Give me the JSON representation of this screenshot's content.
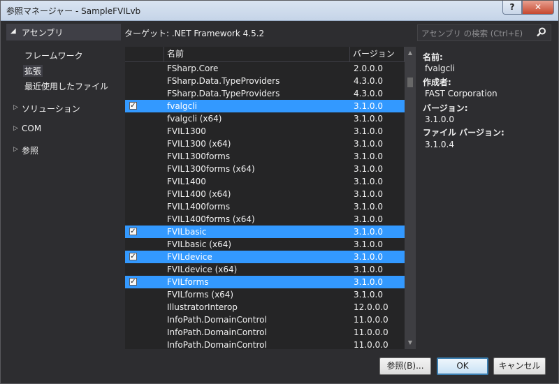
{
  "window": {
    "title": "参照マネージャー - SampleFVILvb",
    "help": "?",
    "close": "✕"
  },
  "left": {
    "header": "アセンブリ",
    "sub_items": [
      "フレームワーク",
      "拡張",
      "最近使用したファイル"
    ],
    "groups": [
      "ソリューション",
      "COM",
      "参照"
    ]
  },
  "target": "ターゲット: .NET Framework 4.5.2",
  "search": {
    "placeholder": "アセンブリ の検索 (Ctrl+E)"
  },
  "list": {
    "columns": [
      "名前",
      "バージョン"
    ],
    "rows": [
      {
        "name": "FSharp.Core",
        "version": "2.0.0.0",
        "checked": false
      },
      {
        "name": "FSharp.Data.TypeProviders",
        "version": "4.3.0.0",
        "checked": false
      },
      {
        "name": "FSharp.Data.TypeProviders",
        "version": "4.3.0.0",
        "checked": false
      },
      {
        "name": "fvalgcli",
        "version": "3.1.0.0",
        "checked": true
      },
      {
        "name": "fvalgcli (x64)",
        "version": "3.1.0.0",
        "checked": false
      },
      {
        "name": "FVIL1300",
        "version": "3.1.0.0",
        "checked": false
      },
      {
        "name": "FVIL1300 (x64)",
        "version": "3.1.0.0",
        "checked": false
      },
      {
        "name": "FVIL1300forms",
        "version": "3.1.0.0",
        "checked": false
      },
      {
        "name": "FVIL1300forms (x64)",
        "version": "3.1.0.0",
        "checked": false
      },
      {
        "name": "FVIL1400",
        "version": "3.1.0.0",
        "checked": false
      },
      {
        "name": "FVIL1400 (x64)",
        "version": "3.1.0.0",
        "checked": false
      },
      {
        "name": "FVIL1400forms",
        "version": "3.1.0.0",
        "checked": false
      },
      {
        "name": "FVIL1400forms (x64)",
        "version": "3.1.0.0",
        "checked": false
      },
      {
        "name": "FVILbasic",
        "version": "3.1.0.0",
        "checked": true
      },
      {
        "name": "FVILbasic (x64)",
        "version": "3.1.0.0",
        "checked": false
      },
      {
        "name": "FVILdevice",
        "version": "3.1.0.0",
        "checked": true
      },
      {
        "name": "FVILdevice (x64)",
        "version": "3.1.0.0",
        "checked": false
      },
      {
        "name": "FVILforms",
        "version": "3.1.0.0",
        "checked": true
      },
      {
        "name": "FVILforms (x64)",
        "version": "3.1.0.0",
        "checked": false
      },
      {
        "name": "IllustratorInterop",
        "version": "12.0.0.0",
        "checked": false
      },
      {
        "name": "InfoPath.DomainControl",
        "version": "11.0.0.0",
        "checked": false
      },
      {
        "name": "InfoPath.DomainControl",
        "version": "11.0.0.0",
        "checked": false
      },
      {
        "name": "InfoPath.DomainControl",
        "version": "11.0.0.0",
        "checked": false
      }
    ]
  },
  "detail": {
    "name_label": "名前:",
    "name_value": "fvalgcli",
    "author_label": "作成者:",
    "author_value": "FAST Corporation",
    "version_label": "バージョン:",
    "version_value": "3.1.0.0",
    "file_version_label": "ファイル バージョン:",
    "file_version_value": "3.1.0.4"
  },
  "buttons": {
    "browse": "参照(B)...",
    "ok": "OK",
    "cancel": "キャンセル"
  },
  "colors": {
    "background": "#2d2d30",
    "selection": "#3399ff",
    "list_bg": "#252526"
  }
}
